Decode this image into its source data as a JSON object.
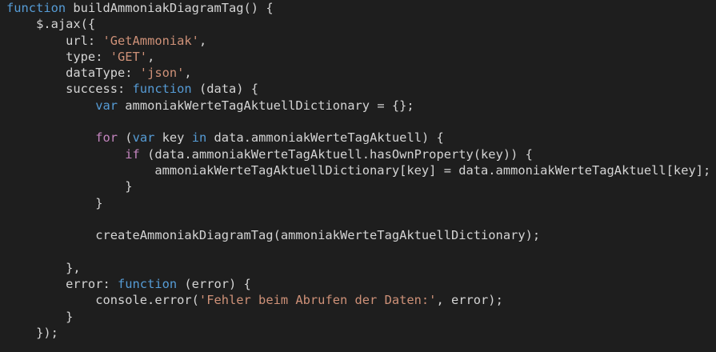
{
  "editor": {
    "language": "javascript",
    "background": "#1e1e1e",
    "colors": {
      "keyword": "#569cd6",
      "control": "#c586c0",
      "string": "#ce9178",
      "function": "#dcdcaa",
      "variable": "#9cdcfe",
      "text": "#d4d4d4"
    },
    "lines": [
      [
        {
          "t": "kw",
          "v": "function"
        },
        {
          "t": "plain",
          "v": " buildAmmoniakDiagramTag() {"
        }
      ],
      [
        {
          "t": "plain",
          "v": "    $.ajax({"
        }
      ],
      [
        {
          "t": "plain",
          "v": "        url: "
        },
        {
          "t": "str",
          "v": "'GetAmmoniak'"
        },
        {
          "t": "plain",
          "v": ","
        }
      ],
      [
        {
          "t": "plain",
          "v": "        type: "
        },
        {
          "t": "str",
          "v": "'GET'"
        },
        {
          "t": "plain",
          "v": ","
        }
      ],
      [
        {
          "t": "plain",
          "v": "        dataType: "
        },
        {
          "t": "str",
          "v": "'json'"
        },
        {
          "t": "plain",
          "v": ","
        }
      ],
      [
        {
          "t": "plain",
          "v": "        success: "
        },
        {
          "t": "kw",
          "v": "function"
        },
        {
          "t": "plain",
          "v": " (data) {"
        }
      ],
      [
        {
          "t": "plain",
          "v": "            "
        },
        {
          "t": "kw",
          "v": "var"
        },
        {
          "t": "plain",
          "v": " ammoniakWerteTagAktuellDictionary = {};"
        }
      ],
      [
        {
          "t": "plain",
          "v": ""
        }
      ],
      [
        {
          "t": "plain",
          "v": "            "
        },
        {
          "t": "kw2",
          "v": "for"
        },
        {
          "t": "plain",
          "v": " ("
        },
        {
          "t": "kw",
          "v": "var"
        },
        {
          "t": "plain",
          "v": " key "
        },
        {
          "t": "kw",
          "v": "in"
        },
        {
          "t": "plain",
          "v": " data.ammoniakWerteTagAktuell) {"
        }
      ],
      [
        {
          "t": "plain",
          "v": "                "
        },
        {
          "t": "kw2",
          "v": "if"
        },
        {
          "t": "plain",
          "v": " (data.ammoniakWerteTagAktuell.hasOwnProperty(key)) {"
        }
      ],
      [
        {
          "t": "plain",
          "v": "                    ammoniakWerteTagAktuellDictionary[key] = data.ammoniakWerteTagAktuell[key];"
        }
      ],
      [
        {
          "t": "plain",
          "v": "                }"
        }
      ],
      [
        {
          "t": "plain",
          "v": "            }"
        }
      ],
      [
        {
          "t": "plain",
          "v": ""
        }
      ],
      [
        {
          "t": "plain",
          "v": "            createAmmoniakDiagramTag(ammoniakWerteTagAktuellDictionary);"
        }
      ],
      [
        {
          "t": "plain",
          "v": ""
        }
      ],
      [
        {
          "t": "plain",
          "v": "        },"
        }
      ],
      [
        {
          "t": "plain",
          "v": "        error: "
        },
        {
          "t": "kw",
          "v": "function"
        },
        {
          "t": "plain",
          "v": " (error) {"
        }
      ],
      [
        {
          "t": "plain",
          "v": "            console.error("
        },
        {
          "t": "str",
          "v": "'Fehler beim Abrufen der Daten:'"
        },
        {
          "t": "plain",
          "v": ", error);"
        }
      ],
      [
        {
          "t": "plain",
          "v": "        }"
        }
      ],
      [
        {
          "t": "plain",
          "v": "    });"
        }
      ]
    ]
  }
}
